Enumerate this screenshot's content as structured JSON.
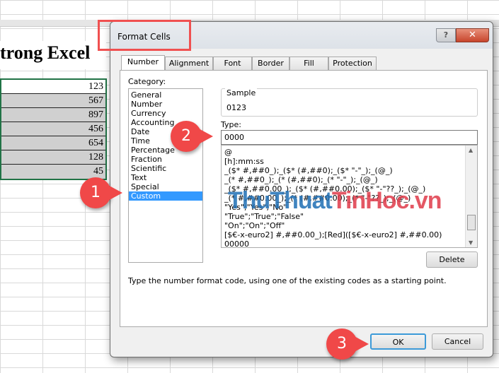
{
  "sheet": {
    "title": "trong Excel",
    "values": [
      "123",
      "567",
      "897",
      "456",
      "654",
      "128",
      "45"
    ]
  },
  "dialog": {
    "title": "Format Cells",
    "help_label": "?",
    "close_label": "✕",
    "tabs": [
      "Number",
      "Alignment",
      "Font",
      "Border",
      "Fill",
      "Protection"
    ],
    "category_label": "Category:",
    "categories": [
      "General",
      "Number",
      "Currency",
      "Accounting",
      "Date",
      "Time",
      "Percentage",
      "Fraction",
      "Scientific",
      "Text",
      "Special",
      "Custom"
    ],
    "selected_category": "Custom",
    "sample_label": "Sample",
    "sample_value": "0123",
    "type_label": "Type:",
    "type_value": "0000",
    "formats": [
      "@",
      "[h]:mm:ss",
      "_($* #,##0_);_($* (#,##0);_($* \"-\"_);_(@_)",
      "_(* #,##0_);_(* (#,##0);_(* \"-\"_);_(@_)",
      "_($* #,##0.00_);_($* (#,##0.00);_($* \"-\"??_);_(@_)",
      "_(* #,##0.00_);_(* (#,##0.00);_(* \"-\"??_);_(@_)",
      "\"Yes\";\"Yes\";\"No\"",
      "\"True\";\"True\";\"False\"",
      "\"On\";\"On\";\"Off\"",
      "[$€-x-euro2] #,##0.00_);[Red]([$€-x-euro2] #,##0.00)",
      "00000"
    ],
    "delete_label": "Delete",
    "description": "Type the number format code, using one of the existing codes as a starting point.",
    "ok_label": "OK",
    "cancel_label": "Cancel"
  },
  "badges": [
    "1",
    "2",
    "3"
  ],
  "watermark": {
    "part1": "ThuThuat",
    "part2": "TinHoc",
    "part3": ".vn",
    "color1": "#1f6fb5",
    "color2": "#e03a4a"
  },
  "colors": {
    "accent": "#f04848",
    "selection": "#3399ff",
    "sheet_border": "#217346"
  }
}
